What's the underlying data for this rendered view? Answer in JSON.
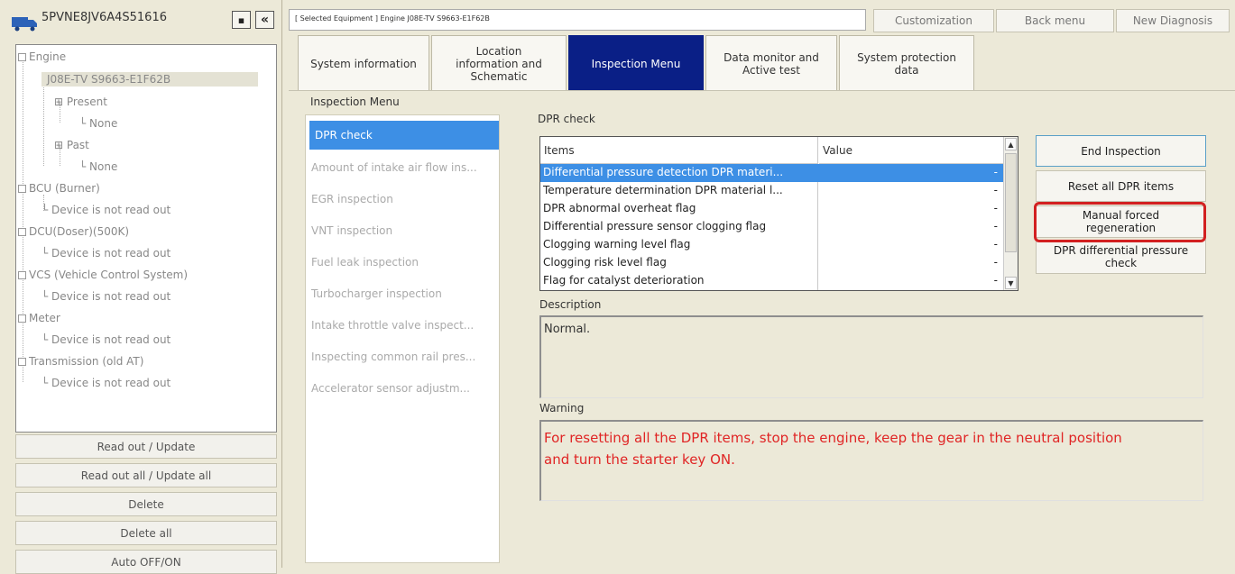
{
  "vin": "5PVNE8JV6A4S51616",
  "icons": {
    "truck": "truck-icon",
    "small_btn": "menu-icon",
    "collapse": "double-chevron-left-icon"
  },
  "collapse_label": "«",
  "tree": {
    "engine": "Engine",
    "engine_model": "J08E-TV S9663-E1F62B",
    "present": "Present",
    "present_none": "None",
    "past": "Past",
    "past_none": "None",
    "bcu": "BCU (Burner)",
    "bcu_status": "Device is not read out",
    "dcu": "DCU(Doser)(500K)",
    "dcu_status": "Device is not read out",
    "vcs": "VCS (Vehicle Control System)",
    "vcs_status": "Device is not read out",
    "meter": "Meter",
    "meter_status": "Device is not read out",
    "transmission": "Transmission (old AT)",
    "transmission_status": "Device is not read out"
  },
  "left_buttons": {
    "read_out": "Read out / Update",
    "read_out_all": "Read out all / Update all",
    "delete": "Delete",
    "delete_all": "Delete all",
    "auto_off_on": "Auto OFF/ON"
  },
  "selected_equipment": "[ Selected Equipment ] Engine J08E-TV S9663-E1F62B",
  "top_buttons": {
    "customization": "Customization",
    "back_menu": "Back menu",
    "new_diagnosis": "New Diagnosis"
  },
  "tabs": {
    "system_info": "System information",
    "location_1": "Location",
    "location_2": "information and",
    "location_3": "Schematic",
    "inspection": "Inspection Menu",
    "data_monitor_1": "Data monitor and",
    "data_monitor_2": "Active test",
    "system_protection_1": "System protection",
    "system_protection_2": "data"
  },
  "inspection_menu": {
    "title": "Inspection Menu",
    "items": [
      "DPR check",
      "Amount of intake air flow ins...",
      "EGR inspection",
      "VNT inspection",
      "Fuel leak inspection",
      "Turbocharger inspection",
      "Intake throttle valve inspect...",
      "Inspecting common rail pres...",
      "Accelerator sensor adjustm..."
    ]
  },
  "dpr": {
    "title": "DPR check",
    "col_items": "Items",
    "col_value": "Value",
    "rows": [
      {
        "item": "Differential pressure detection DPR materi...",
        "value": "-"
      },
      {
        "item": "Temperature determination DPR material l...",
        "value": "-"
      },
      {
        "item": "DPR abnormal overheat flag",
        "value": "-"
      },
      {
        "item": "Differential pressure sensor clogging flag",
        "value": "-"
      },
      {
        "item": "Clogging warning level flag",
        "value": "-"
      },
      {
        "item": "Clogging risk level flag",
        "value": "-"
      },
      {
        "item": "Flag for catalyst deterioration",
        "value": "-"
      }
    ]
  },
  "right_buttons": {
    "end_inspection": "End Inspection",
    "reset_all": "Reset all DPR items",
    "manual_1": "Manual forced",
    "manual_2": "regeneration",
    "dpr_diff_1": "DPR differential pressure",
    "dpr_diff_2": "check"
  },
  "description": {
    "label": "Description",
    "text": "Normal."
  },
  "warning": {
    "label": "Warning",
    "line1": "For resetting all the DPR items, stop the engine, keep the gear in the neutral position",
    "line2": "and turn the starter key ON."
  },
  "colors": {
    "active_tab": "#0a1f86",
    "selection": "#3d8fe5",
    "warning_text": "#e02525",
    "highlight_ring": "#d22020"
  }
}
